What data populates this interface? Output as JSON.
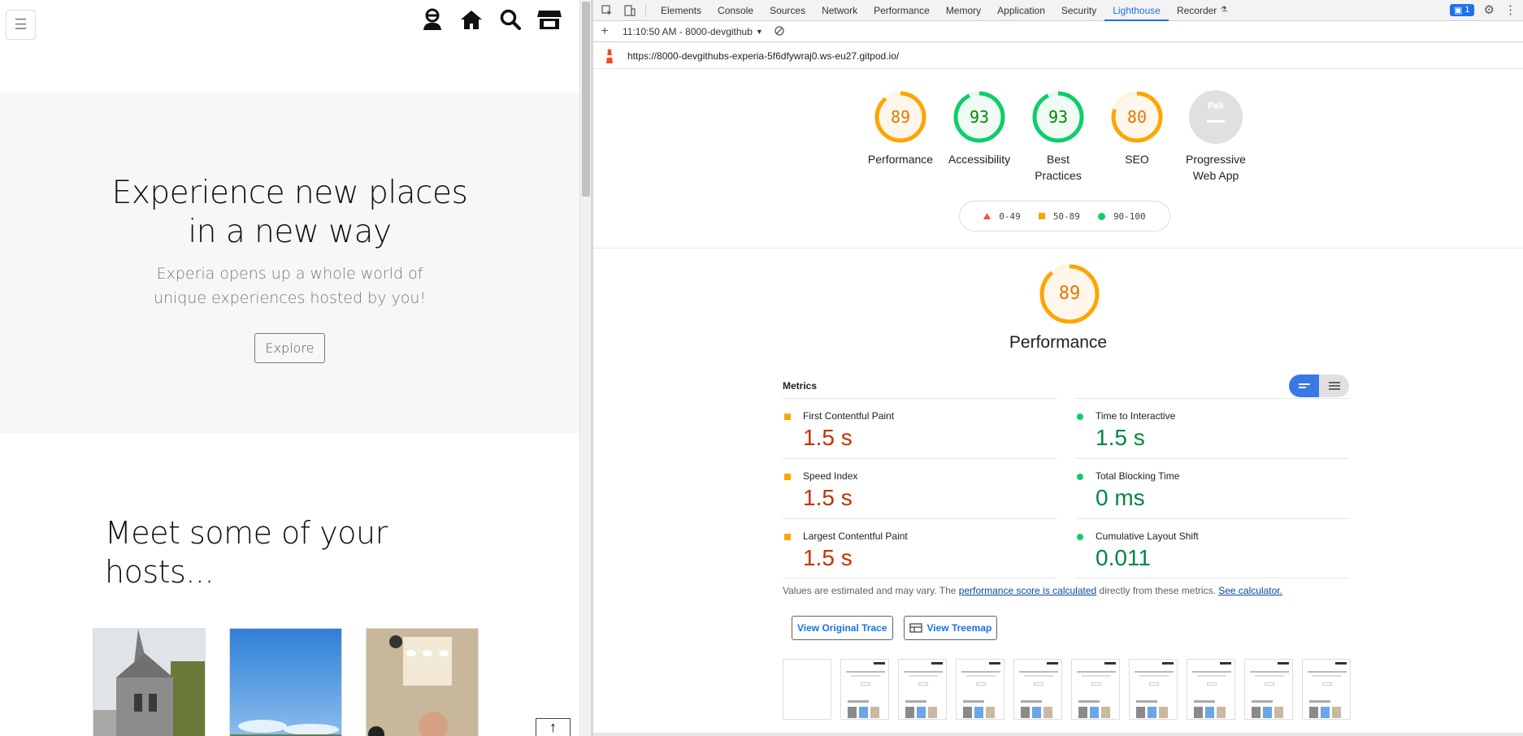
{
  "site": {
    "nav_icons": [
      "user-icon",
      "home-icon",
      "search-icon",
      "store-icon"
    ],
    "hero_title": "Experience new places in a new way",
    "hero_subtitle": "Experia opens up a whole world of unique experiences hosted by you!",
    "hero_button": "Explore",
    "hosts_title": "Meet some of your hosts..."
  },
  "devtools": {
    "tabs": [
      "Elements",
      "Console",
      "Sources",
      "Network",
      "Performance",
      "Memory",
      "Application",
      "Security",
      "Lighthouse",
      "Recorder"
    ],
    "active_tab": "Lighthouse",
    "issues_count": "1",
    "report_label": "11:10:50 AM - 8000-devgithub",
    "url": "https://8000-devgithubs-experia-5f6dfywraj0.ws-eu27.gitpod.io/"
  },
  "scores": [
    {
      "label": "Performance",
      "value": "89",
      "fraction": 0.89,
      "color": "#ffa400",
      "text": "#e67700"
    },
    {
      "label": "Accessibility",
      "value": "93",
      "fraction": 0.93,
      "color": "#0cce6b",
      "text": "#008800"
    },
    {
      "label": "Best Practices",
      "value": "93",
      "fraction": 0.93,
      "color": "#0cce6b",
      "text": "#008800"
    },
    {
      "label": "SEO",
      "value": "80",
      "fraction": 0.8,
      "color": "#ffa400",
      "text": "#e67700"
    },
    {
      "label": "Progressive Web App",
      "value": "PWA",
      "fraction": 0,
      "color": "#ddd",
      "text": "#aaa"
    }
  ],
  "legend": [
    {
      "range": "0-49",
      "shape": "triangle",
      "color": "#ff4e42"
    },
    {
      "range": "50-89",
      "shape": "square",
      "color": "#ffa400"
    },
    {
      "range": "90-100",
      "shape": "circle",
      "color": "#0cce6b"
    }
  ],
  "performance": {
    "score": "89",
    "fraction": 0.89,
    "title": "Performance",
    "metrics_title": "Metrics",
    "metrics": [
      {
        "name": "First Contentful Paint",
        "value": "1.5 s",
        "status": "average"
      },
      {
        "name": "Time to Interactive",
        "value": "1.5 s",
        "status": "pass"
      },
      {
        "name": "Speed Index",
        "value": "1.5 s",
        "status": "average"
      },
      {
        "name": "Total Blocking Time",
        "value": "0 ms",
        "status": "pass"
      },
      {
        "name": "Largest Contentful Paint",
        "value": "1.5 s",
        "status": "average"
      },
      {
        "name": "Cumulative Layout Shift",
        "value": "0.011",
        "status": "pass"
      }
    ],
    "note_prefix": "Values are estimated and may vary. The ",
    "note_link1": "performance score is calculated",
    "note_mid": " directly from these metrics. ",
    "note_link2": "See calculator.",
    "btn_trace": "View Original Trace",
    "btn_treemap": "View Treemap",
    "filmstrip_frames": 10
  }
}
